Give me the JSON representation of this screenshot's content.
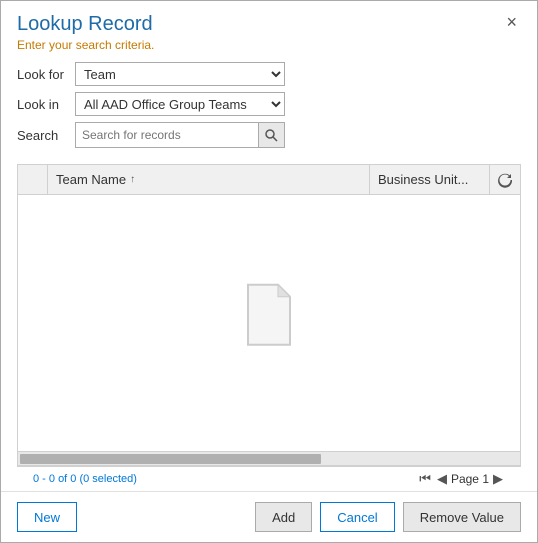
{
  "dialog": {
    "title": "Lookup Record",
    "subtitle": "Enter your search criteria.",
    "close_label": "×"
  },
  "form": {
    "look_for_label": "Look for",
    "look_in_label": "Look in",
    "search_label": "Search",
    "look_for_value": "Team",
    "look_in_value": "All AAD Office Group Teams",
    "search_placeholder": "Search for records",
    "look_for_options": [
      "Team"
    ],
    "look_in_options": [
      "All AAD Office Group Teams"
    ]
  },
  "table": {
    "columns": [
      {
        "id": "team-name",
        "label": "Team Name",
        "sort": "asc"
      },
      {
        "id": "business-unit",
        "label": "Business Unit..."
      }
    ],
    "rows": [],
    "empty": true
  },
  "status": {
    "record_count": "0 - 0 of 0 (0 selected)",
    "page_label": "Page 1"
  },
  "footer": {
    "new_label": "New",
    "add_label": "Add",
    "cancel_label": "Cancel",
    "remove_value_label": "Remove Value"
  }
}
